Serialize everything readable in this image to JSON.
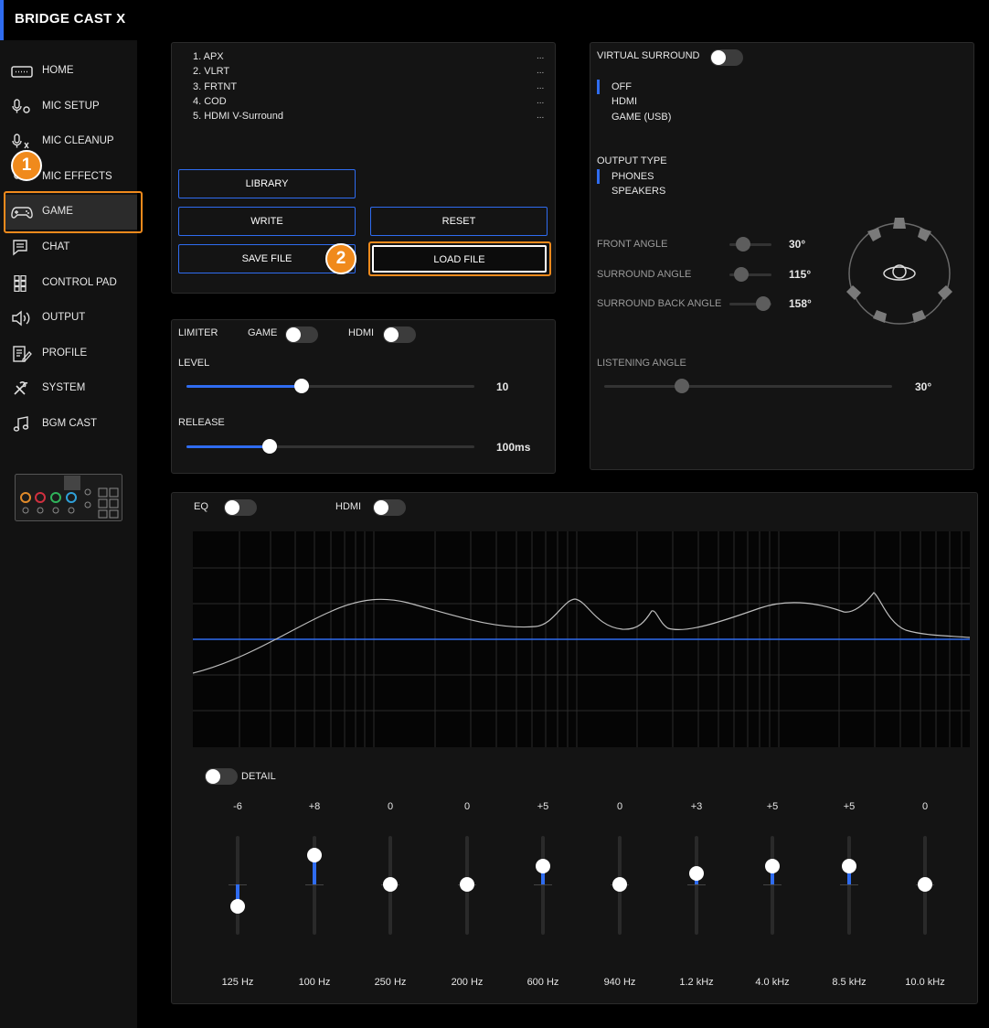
{
  "app": {
    "title": "BRIDGE CAST X"
  },
  "sidebar": {
    "items": [
      {
        "label": "HOME",
        "icon": "keyboard-icon"
      },
      {
        "label": "MIC SETUP",
        "icon": "mic-setup-icon"
      },
      {
        "label": "MIC CLEANUP",
        "icon": "mic-cleanup-icon"
      },
      {
        "label": "MIC EFFECTS",
        "icon": "mic-effects-icon"
      },
      {
        "label": "GAME",
        "icon": "gamepad-icon",
        "active": true
      },
      {
        "label": "CHAT",
        "icon": "chat-icon"
      },
      {
        "label": "CONTROL PAD",
        "icon": "grid-icon"
      },
      {
        "label": "OUTPUT",
        "icon": "speaker-icon"
      },
      {
        "label": "PROFILE",
        "icon": "profile-icon"
      },
      {
        "label": "SYSTEM",
        "icon": "tools-icon"
      },
      {
        "label": "BGM CAST",
        "icon": "music-icon"
      }
    ]
  },
  "callouts": {
    "one": "1",
    "two": "2",
    "color": "#f08a1c"
  },
  "library": {
    "items": [
      "1. APX",
      "2. VLRT",
      "3. FRTNT",
      "4. COD",
      "5. HDMI V-Surround"
    ],
    "dots": "...",
    "buttons": {
      "library": "LIBRARY",
      "write": "WRITE",
      "reset": "RESET",
      "save": "SAVE FILE",
      "load": "LOAD FILE"
    }
  },
  "limiter": {
    "title": "LIMITER",
    "game_label": "GAME",
    "hdmi_label": "HDMI",
    "level_label": "LEVEL",
    "level_value": "10",
    "level_fraction": 0.4,
    "release_label": "RELEASE",
    "release_value": "100ms",
    "release_fraction": 0.29
  },
  "surround": {
    "title": "VIRTUAL SURROUND",
    "modes": [
      "OFF",
      "HDMI",
      "GAME (USB)"
    ],
    "selected_mode": "OFF",
    "output_type_label": "OUTPUT TYPE",
    "output_types": [
      "PHONES",
      "SPEAKERS"
    ],
    "selected_output": "PHONES",
    "front_label": "FRONT ANGLE",
    "front_value": "30°",
    "surround_label": "SURROUND ANGLE",
    "surround_value": "115°",
    "back_label": "SURROUND BACK ANGLE",
    "back_value": "158°",
    "listening_label": "LISTENING ANGLE",
    "listening_value": "30°"
  },
  "eq": {
    "title": "EQ",
    "hdmi_label": "HDMI",
    "detail_label": "DETAIL",
    "range_db": 12,
    "bands": [
      {
        "gain": "-6",
        "freq": "125 Hz",
        "db": -6
      },
      {
        "gain": "+8",
        "freq": "100 Hz",
        "db": 8
      },
      {
        "gain": "0",
        "freq": "250 Hz",
        "db": 0
      },
      {
        "gain": "0",
        "freq": "200 Hz",
        "db": 0
      },
      {
        "gain": "+5",
        "freq": "600 Hz",
        "db": 5
      },
      {
        "gain": "0",
        "freq": "940 Hz",
        "db": 0
      },
      {
        "gain": "+3",
        "freq": "1.2 kHz",
        "db": 3
      },
      {
        "gain": "+5",
        "freq": "4.0 kHz",
        "db": 5
      },
      {
        "gain": "+5",
        "freq": "8.5 kHz",
        "db": 5
      },
      {
        "gain": "0",
        "freq": "10.0 kHz",
        "db": 0
      }
    ]
  },
  "colors": {
    "accent": "#2f6cf0",
    "highlight": "#f08a1c"
  }
}
